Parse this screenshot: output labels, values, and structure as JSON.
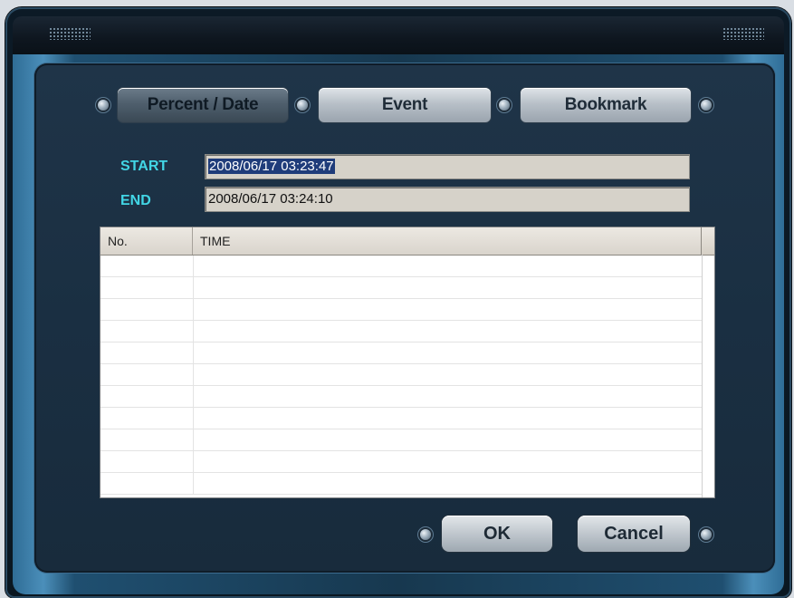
{
  "tabs": [
    {
      "label": "Percent / Date",
      "active": true
    },
    {
      "label": "Event",
      "active": false
    },
    {
      "label": "Bookmark",
      "active": false
    }
  ],
  "range": {
    "start_label": "START",
    "start_value": "2008/06/17 03:23:47",
    "end_label": "END",
    "end_value": "2008/06/17 03:24:10"
  },
  "table": {
    "columns": [
      "No.",
      "TIME"
    ],
    "rows": []
  },
  "buttons": {
    "ok_label": "OK",
    "cancel_label": "Cancel"
  },
  "colors": {
    "accent_label": "#42d6e6",
    "panel": "#1a2f42",
    "selection": "#1f3c7a"
  }
}
